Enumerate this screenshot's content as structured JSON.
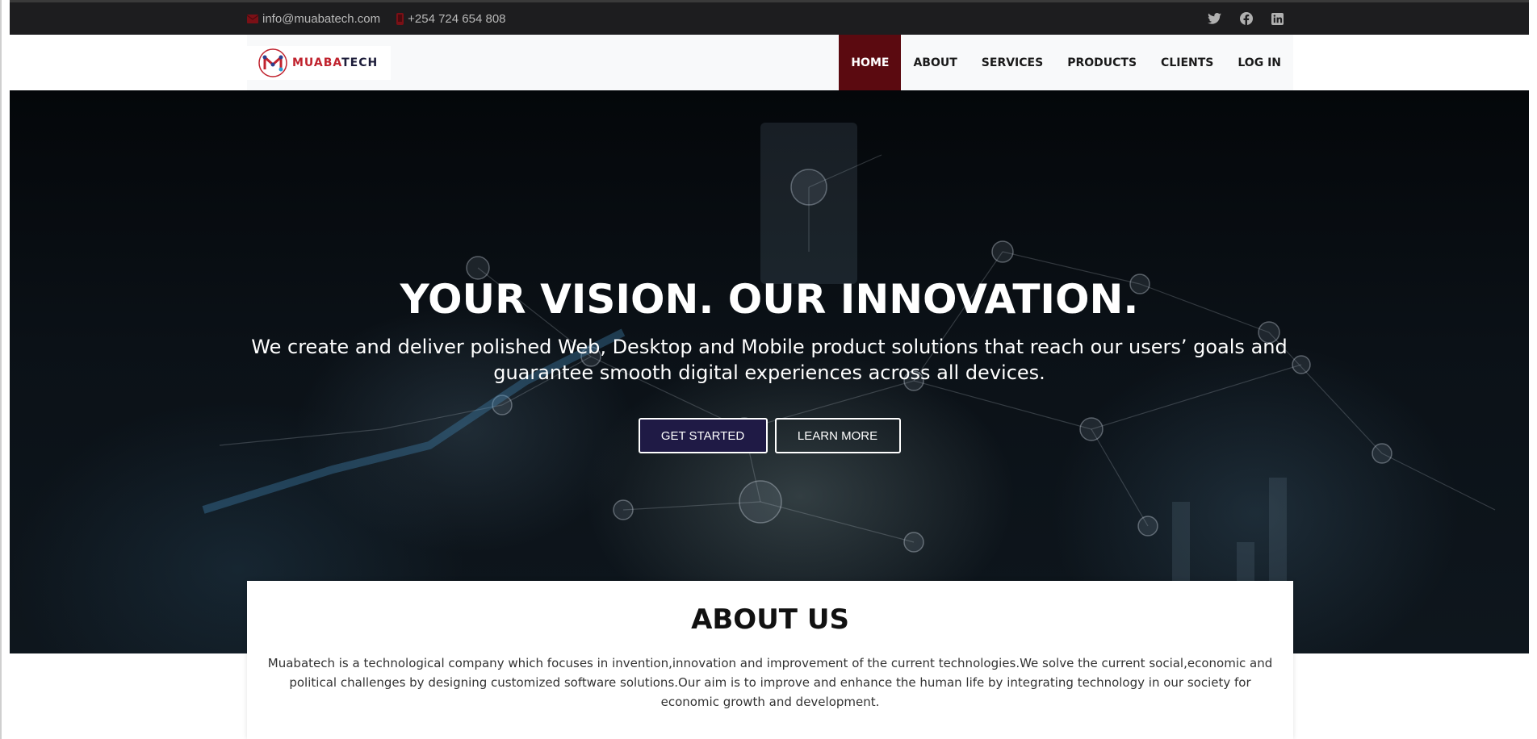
{
  "topbar": {
    "email": "info@muabatech.com",
    "phone": "+254 724 654 808",
    "social_icons": [
      "twitter-icon",
      "facebook-icon",
      "linkedin-icon"
    ]
  },
  "header": {
    "logo": {
      "part1": "MUABA",
      "part2": "TECH"
    },
    "nav": [
      {
        "label": "HOME",
        "active": true
      },
      {
        "label": "ABOUT"
      },
      {
        "label": "SERVICES"
      },
      {
        "label": "PRODUCTS"
      },
      {
        "label": "CLIENTS"
      },
      {
        "label": "LOG IN"
      }
    ]
  },
  "hero": {
    "title": "YOUR VISION. OUR INNOVATION.",
    "subtitle": "We create and deliver polished Web, Desktop and Mobile product solutions that reach our users’ goals and guarantee smooth digital experiences across all devices.",
    "primary_button": "GET STARTED",
    "secondary_button": "LEARN MORE"
  },
  "about": {
    "title": "ABOUT US",
    "text": "Muabatech is a technological company which focuses in invention,innovation and improvement of the current technologies.We solve the current social,economic and political challenges by designing customized software solutions.Our aim is to improve and enhance the human life by integrating technology in our society for economic growth and development."
  },
  "colors": {
    "accent": "#5b0a10",
    "topbar": "#1d1d1f",
    "primary_button": "#1f1a45",
    "logo_red": "#c0232e"
  }
}
